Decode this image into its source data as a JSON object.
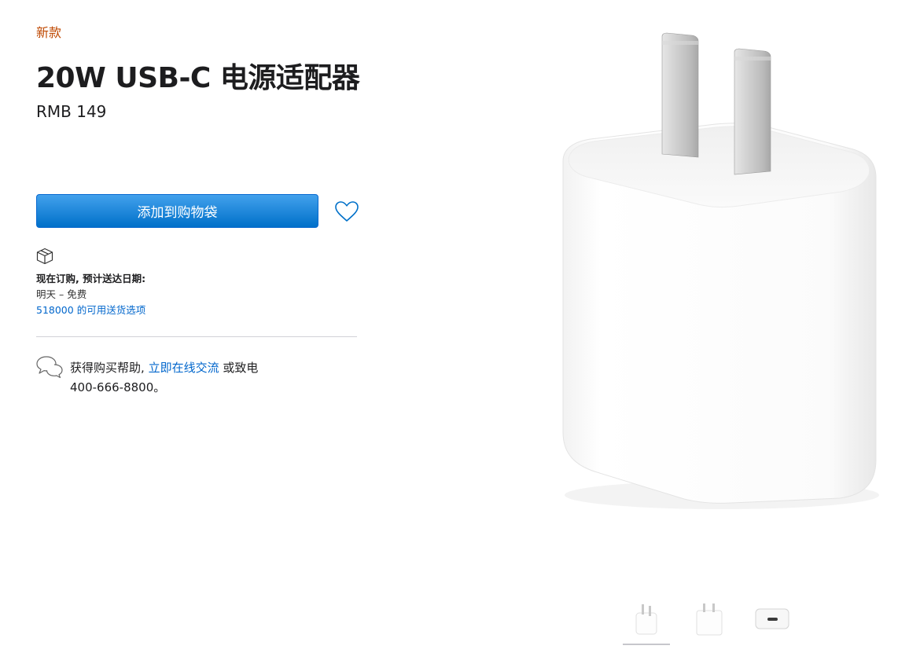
{
  "product": {
    "badge": "新款",
    "title": "20W USB-C 电源适配器",
    "price": "RMB 149"
  },
  "actions": {
    "add_to_bag": "添加到购物袋",
    "favorite_icon": "heart-icon"
  },
  "delivery": {
    "icon": "box-icon",
    "label": "现在订购, 预计送达日期:",
    "value": "明天 – 免费",
    "link": "518000 的可用送货选项"
  },
  "help": {
    "icon": "chat-bubbles-icon",
    "prefix": "获得购买帮助,",
    "link": "立即在线交流",
    "suffix": "或致电",
    "phone": "400-666-8800。"
  },
  "gallery": {
    "selected_index": 0,
    "thumbnails": [
      "adapter-front",
      "adapter-side",
      "adapter-bottom-usb-c"
    ]
  },
  "colors": {
    "badge": "#bf4800",
    "button_top": "#42a1ec",
    "button_bottom": "#0070c9",
    "link": "#0066cc"
  }
}
